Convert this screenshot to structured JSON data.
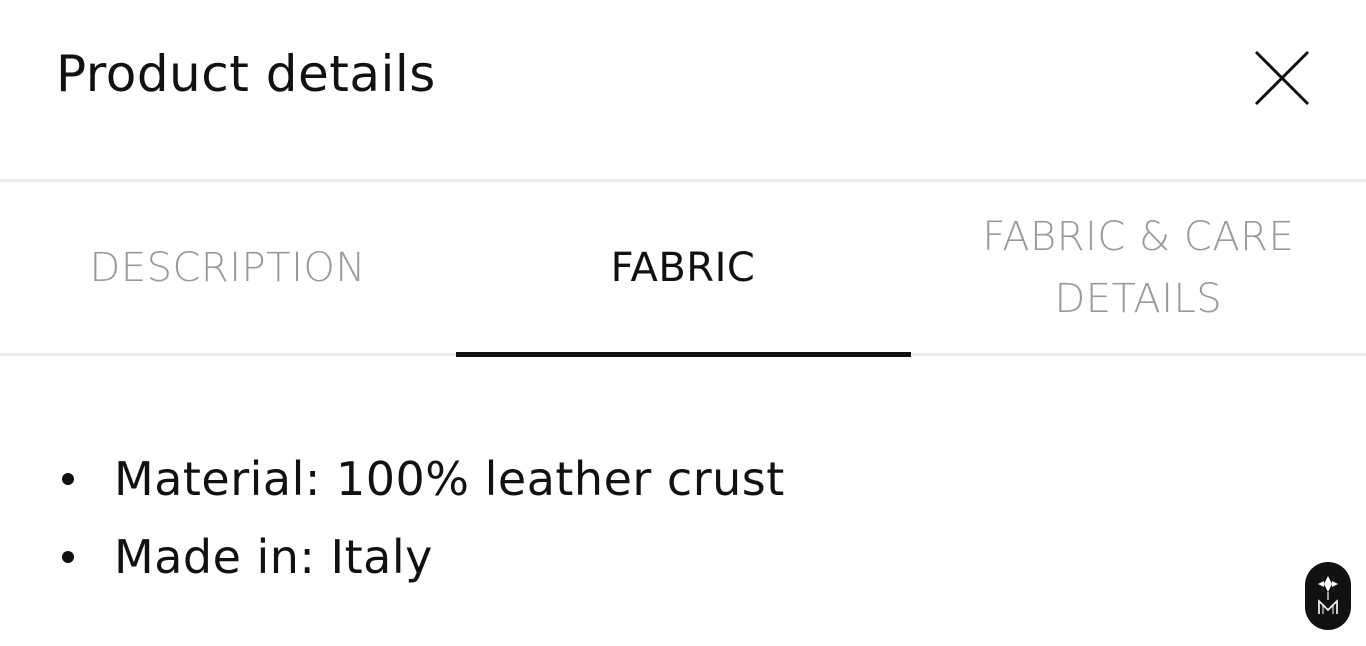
{
  "header": {
    "title": "Product details",
    "close_icon": "close-icon"
  },
  "tabs": [
    {
      "label": "DESCRIPTION",
      "active": false
    },
    {
      "label": "FABRIC",
      "active": true
    },
    {
      "label": "FABRIC & CARE DETAILS",
      "active": false
    }
  ],
  "content": {
    "items": [
      "Material: 100% leather crust",
      "Made in: Italy"
    ]
  },
  "floating_button": {
    "icon": "brand-logo-icon"
  },
  "colors": {
    "text": "#111111",
    "inactive_tab": "#9a9a9a",
    "divider": "#ececec",
    "background": "#ffffff"
  }
}
